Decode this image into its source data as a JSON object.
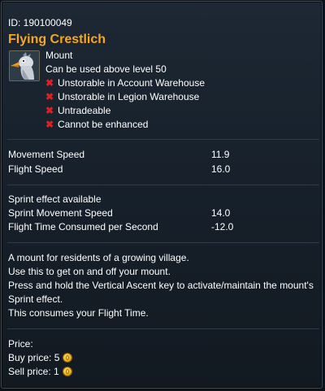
{
  "item": {
    "id_label": "ID: 190100049",
    "name": "Flying Crestlich",
    "icon": "flying-crestlich-mount-icon",
    "type": "Mount",
    "level_req": "Can be used above level 50",
    "restrictions": [
      "Unstorable in Account Warehouse",
      "Unstorable in Legion Warehouse",
      "Untradeable",
      "Cannot be enhanced"
    ]
  },
  "stats": {
    "movement_speed_label": "Movement Speed",
    "movement_speed_value": "11.9",
    "flight_speed_label": "Flight Speed",
    "flight_speed_value": "16.0"
  },
  "sprint": {
    "available": "Sprint effect available",
    "movement_label": "Sprint Movement Speed",
    "movement_value": "14.0",
    "flight_time_label": "Flight Time Consumed per Second",
    "flight_time_value": "-12.0"
  },
  "description": [
    "A mount for residents of a growing village.",
    "Use this to get on and off your mount.",
    "Press and hold the Vertical Ascent key to activate/maintain the mount's",
    "Sprint effect.",
    "This consumes your Flight Time."
  ],
  "price": {
    "title": "Price:",
    "buy": "Buy price: 5",
    "sell": "Sell price: 1",
    "coin_icon": "gold-coin-icon"
  },
  "colors": {
    "name": "#f5a623",
    "restriction_icon": "#e02020",
    "background": "#1a232e",
    "border": "#3c4d60"
  }
}
